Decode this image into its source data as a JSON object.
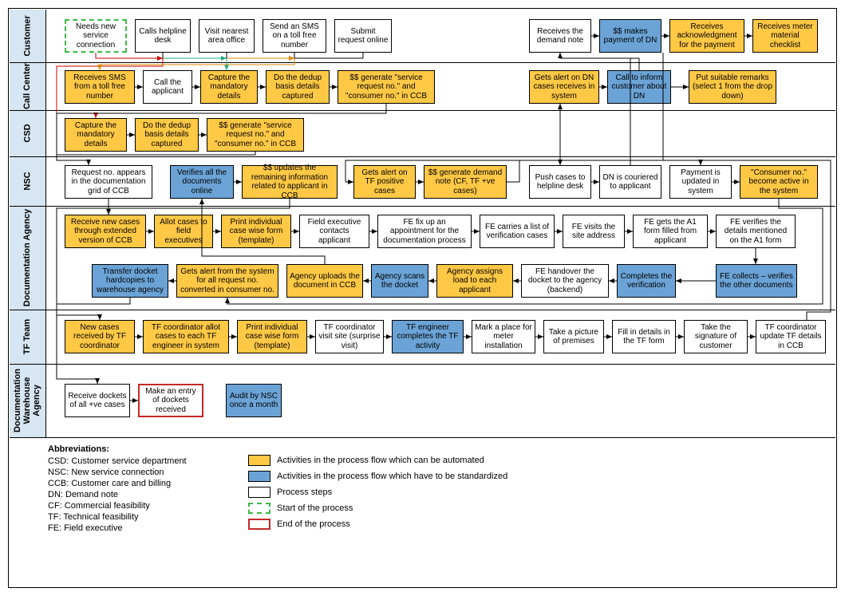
{
  "lanes": {
    "customer": "Customer",
    "callCenter": "Call Center",
    "csd": "CSD",
    "nsc": "NSC",
    "docAgency": "Documentation Agency",
    "tfTeam": "TF Team",
    "docWarehouse": "Documentation\nWarehouse\nAgency"
  },
  "b": {
    "c1": "Needs new service connection",
    "c2": "Calls helpline desk",
    "c3": "Visit nearest area office",
    "c4": "Send an SMS on a toll free number",
    "c5": "Submit request online",
    "c6": "Receives the demand note",
    "c7": "$$ makes payment of DN",
    "c8": "Receives acknowledgment for the payment",
    "c9": "Receives meter material checklist",
    "cc1": "Receives SMS from a toll free number",
    "cc2": "Call the applicant",
    "cc3": "Capture the mandatory details",
    "cc4": "Do the dedup basis details captured",
    "cc5": "$$ generate \"service request no.\" and \"consumer no.\" in CCB",
    "cc6": "Gets alert on DN cases receives in system",
    "cc7": "Call to inform customer about DN",
    "cc8": "Put suitable remarks (select 1 from the drop down)",
    "csd1": "Capture the mandatory details",
    "csd2": "Do the dedup basis details captured",
    "csd3": "$$ generate \"service request no.\" and \"consumer no.\" in CCB",
    "n1": "Request no. appears in the documentation grid of CCB",
    "n2": "Verifies all the documents online",
    "n3": "$$ updates the remaining information related to applicant in CCB",
    "n4": "Gets alert on TF positive cases",
    "n5": "$$ generate demand note (CF, TF +ve cases)",
    "n6": "Push cases to helpline desk",
    "n7": "DN is couriered to applicant",
    "n8": "Payment is updated in system",
    "n9": "\"Consumer no.\" become active in the system",
    "d1": "Receive new cases through extended version of CCB",
    "d2": "Allot cases to field executives",
    "d3": "Print individual case wise form (template)",
    "d4": "Field executive contacts applicant",
    "d5": "FE fix up an appointment for the documentation process",
    "d6": "FE carries a list of verification cases",
    "d7": "FE visits the site address",
    "d8": "FE gets the A1 form filled from applicant",
    "d9": "FE verifies the details mentioned on the A1 form",
    "d10": "Transfer docket hardcopies to warehouse agency",
    "d11": "Gets alert from the system for all request no. converted in consumer no.",
    "d12": "Agency uploads the document in CCB",
    "d13": "Agency scans the docket",
    "d14": "Agency assigns load to each applicant",
    "d15": "FE handover the docket to the agency (backend)",
    "d16": "Completes the verification",
    "d17": "FE collects – verifies the other documents",
    "t1": "New cases received by TF coordinator",
    "t2": "TF coordinator allot cases to each TF engineer in system",
    "t3": "Print individual case wise form (template)",
    "t4": "TF coordinator visit site (surprise visit)",
    "t5": "TF engineer completes the TF activity",
    "t6": "Mark a place for meter installation",
    "t7": "Take a picture of premises",
    "t8": "Fill in details in the TF form",
    "t9": "Take the signature of customer",
    "t10": "TF coordinator update TF details in CCB",
    "w1": "Receive dockets of all +ve cases",
    "w2": "Make an entry of dockets received",
    "w3": "Audit by NSC once a month"
  },
  "abbr": {
    "title": "Abbreviations:",
    "l1": "CSD: Customer service department",
    "l2": "NSC: New service connection",
    "l3": "CCB: Customer care and billing",
    "l4": "DN: Demand note",
    "l5": "CF: Commercial feasibility",
    "l6": "TF: Technical feasibility",
    "l7": "FE: Field executive"
  },
  "legend": {
    "l1": "Activities in the process flow which can be automated",
    "l2": "Activities in the process flow which have to be standardized",
    "l3": "Process steps",
    "l4": "Start of the process",
    "l5": "End of the process"
  }
}
